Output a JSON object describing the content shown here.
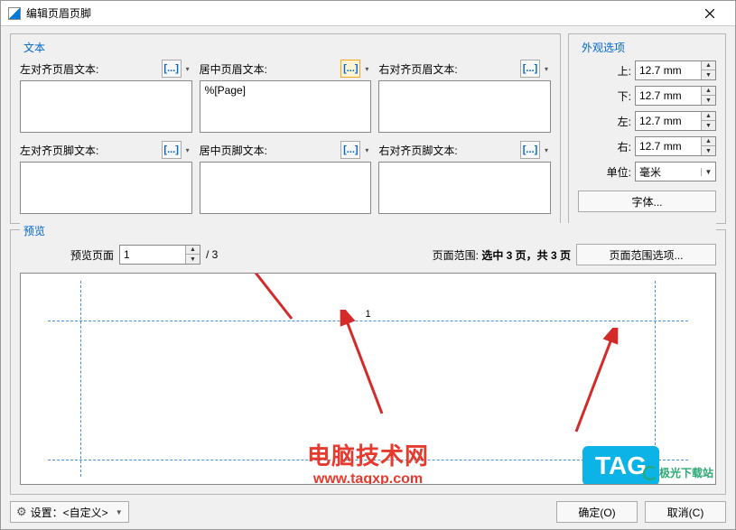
{
  "title": "编辑页眉页脚",
  "text_panel": {
    "title": "文本",
    "fields": [
      {
        "label": "左对齐页眉文本:",
        "value": ""
      },
      {
        "label": "居中页眉文本:",
        "value": "%[Page]"
      },
      {
        "label": "右对齐页眉文本:",
        "value": ""
      },
      {
        "label": "左对齐页脚文本:",
        "value": ""
      },
      {
        "label": "居中页脚文本:",
        "value": ""
      },
      {
        "label": "右对齐页脚文本:",
        "value": ""
      }
    ],
    "insert_icon": "[...]"
  },
  "appearance": {
    "title": "外观选项",
    "top_label": "上:",
    "top_value": "12.7 mm",
    "bottom_label": "下:",
    "bottom_value": "12.7 mm",
    "left_label": "左:",
    "left_value": "12.7 mm",
    "right_label": "右:",
    "right_value": "12.7 mm",
    "unit_label": "单位:",
    "unit_value": "毫米",
    "font_btn": "字体..."
  },
  "preview": {
    "title": "预览",
    "page_label": "预览页面",
    "page_value": "1",
    "page_total": "/ 3",
    "range_label_prefix": "页面范围: ",
    "range_info": "选中 3 页，共 3 页",
    "range_btn": "页面范围选项...",
    "shown_page_number": "1"
  },
  "bottom": {
    "settings_label": "设置：<自定义>",
    "ok": "确定(O)",
    "cancel": "取消(C)"
  },
  "watermark": {
    "text": "电脑技术网",
    "url": "www.tagxp.com",
    "tag": "TAG",
    "jg": "极光下载站"
  }
}
